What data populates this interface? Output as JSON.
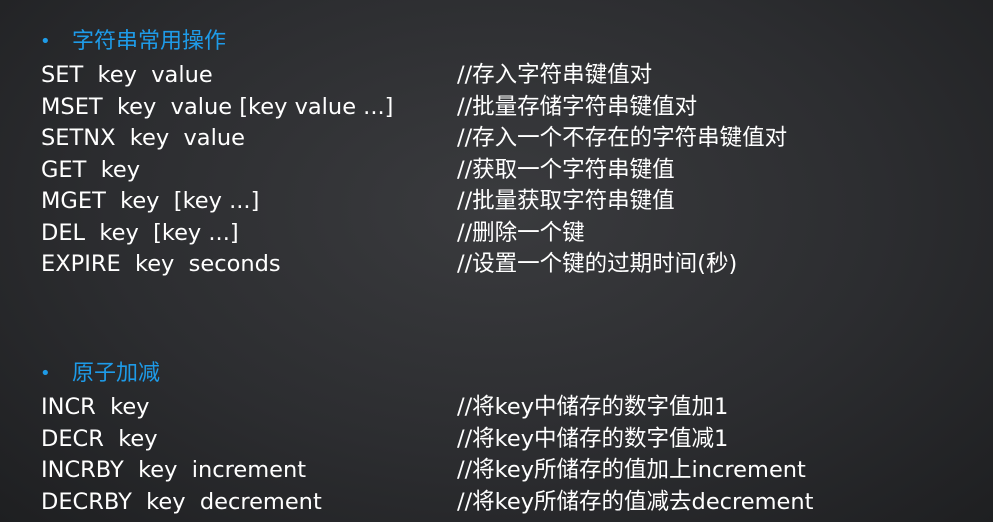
{
  "sections": [
    {
      "bullet": "•",
      "title": "字符串常用操作",
      "rows": [
        {
          "command": "SET  key  value",
          "comment": "//存入字符串键值对"
        },
        {
          "command": "MSET  key  value [key value ...]",
          "comment": "//批量存储字符串键值对"
        },
        {
          "command": "SETNX  key  value",
          "comment": "//存入一个不存在的字符串键值对"
        },
        {
          "command": "GET  key",
          "comment": "//获取一个字符串键值"
        },
        {
          "command": "MGET  key  [key ...]",
          "comment": "//批量获取字符串键值"
        },
        {
          "command": "DEL  key  [key ...]",
          "comment": "//删除一个键"
        },
        {
          "command": "EXPIRE  key  seconds",
          "comment": "//设置一个键的过期时间(秒)"
        }
      ]
    },
    {
      "bullet": "•",
      "title": "原子加减",
      "rows": [
        {
          "command": "INCR  key",
          "comment": "//将key中储存的数字值加1"
        },
        {
          "command": "DECR  key",
          "comment": "//将key中储存的数字值减1"
        },
        {
          "command": "INCRBY  key  increment",
          "comment": "//将key所储存的值加上increment"
        },
        {
          "command": "DECRBY  key  decrement",
          "comment": "//将key所储存的值减去decrement"
        }
      ]
    }
  ],
  "colors": {
    "accent": "#1e9be8",
    "text": "#ffffff",
    "background": "#2c2d30"
  }
}
